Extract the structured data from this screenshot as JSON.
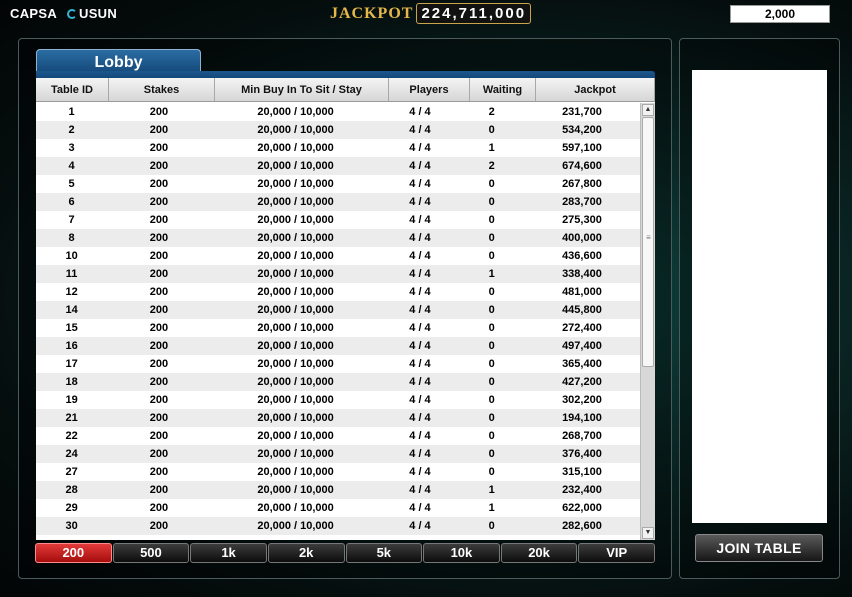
{
  "header": {
    "logo_left": "CAPSA",
    "logo_right": "USUN",
    "jackpot_label": "JACKPOT",
    "jackpot_value": "224,711,000",
    "balance": "2,000"
  },
  "lobby": {
    "tab_label": "Lobby",
    "columns": [
      "Table ID",
      "Stakes",
      "Min Buy In To Sit / Stay",
      "Players",
      "Waiting",
      "Jackpot"
    ],
    "rows": [
      {
        "id": "1",
        "stakes": "200",
        "buyin": "20,000 / 10,000",
        "players": "4 / 4",
        "waiting": "2",
        "jackpot": "231,700"
      },
      {
        "id": "2",
        "stakes": "200",
        "buyin": "20,000 / 10,000",
        "players": "4 / 4",
        "waiting": "0",
        "jackpot": "534,200"
      },
      {
        "id": "3",
        "stakes": "200",
        "buyin": "20,000 / 10,000",
        "players": "4 / 4",
        "waiting": "1",
        "jackpot": "597,100"
      },
      {
        "id": "4",
        "stakes": "200",
        "buyin": "20,000 / 10,000",
        "players": "4 / 4",
        "waiting": "2",
        "jackpot": "674,600"
      },
      {
        "id": "5",
        "stakes": "200",
        "buyin": "20,000 / 10,000",
        "players": "4 / 4",
        "waiting": "0",
        "jackpot": "267,800"
      },
      {
        "id": "6",
        "stakes": "200",
        "buyin": "20,000 / 10,000",
        "players": "4 / 4",
        "waiting": "0",
        "jackpot": "283,700"
      },
      {
        "id": "7",
        "stakes": "200",
        "buyin": "20,000 / 10,000",
        "players": "4 / 4",
        "waiting": "0",
        "jackpot": "275,300"
      },
      {
        "id": "8",
        "stakes": "200",
        "buyin": "20,000 / 10,000",
        "players": "4 / 4",
        "waiting": "0",
        "jackpot": "400,000"
      },
      {
        "id": "10",
        "stakes": "200",
        "buyin": "20,000 / 10,000",
        "players": "4 / 4",
        "waiting": "0",
        "jackpot": "436,600"
      },
      {
        "id": "11",
        "stakes": "200",
        "buyin": "20,000 / 10,000",
        "players": "4 / 4",
        "waiting": "1",
        "jackpot": "338,400"
      },
      {
        "id": "12",
        "stakes": "200",
        "buyin": "20,000 / 10,000",
        "players": "4 / 4",
        "waiting": "0",
        "jackpot": "481,000"
      },
      {
        "id": "14",
        "stakes": "200",
        "buyin": "20,000 / 10,000",
        "players": "4 / 4",
        "waiting": "0",
        "jackpot": "445,800"
      },
      {
        "id": "15",
        "stakes": "200",
        "buyin": "20,000 / 10,000",
        "players": "4 / 4",
        "waiting": "0",
        "jackpot": "272,400"
      },
      {
        "id": "16",
        "stakes": "200",
        "buyin": "20,000 / 10,000",
        "players": "4 / 4",
        "waiting": "0",
        "jackpot": "497,400"
      },
      {
        "id": "17",
        "stakes": "200",
        "buyin": "20,000 / 10,000",
        "players": "4 / 4",
        "waiting": "0",
        "jackpot": "365,400"
      },
      {
        "id": "18",
        "stakes": "200",
        "buyin": "20,000 / 10,000",
        "players": "4 / 4",
        "waiting": "0",
        "jackpot": "427,200"
      },
      {
        "id": "19",
        "stakes": "200",
        "buyin": "20,000 / 10,000",
        "players": "4 / 4",
        "waiting": "0",
        "jackpot": "302,200"
      },
      {
        "id": "21",
        "stakes": "200",
        "buyin": "20,000 / 10,000",
        "players": "4 / 4",
        "waiting": "0",
        "jackpot": "194,100"
      },
      {
        "id": "22",
        "stakes": "200",
        "buyin": "20,000 / 10,000",
        "players": "4 / 4",
        "waiting": "0",
        "jackpot": "268,700"
      },
      {
        "id": "24",
        "stakes": "200",
        "buyin": "20,000 / 10,000",
        "players": "4 / 4",
        "waiting": "0",
        "jackpot": "376,400"
      },
      {
        "id": "27",
        "stakes": "200",
        "buyin": "20,000 / 10,000",
        "players": "4 / 4",
        "waiting": "0",
        "jackpot": "315,100"
      },
      {
        "id": "28",
        "stakes": "200",
        "buyin": "20,000 / 10,000",
        "players": "4 / 4",
        "waiting": "1",
        "jackpot": "232,400"
      },
      {
        "id": "29",
        "stakes": "200",
        "buyin": "20,000 / 10,000",
        "players": "4 / 4",
        "waiting": "1",
        "jackpot": "622,000"
      },
      {
        "id": "30",
        "stakes": "200",
        "buyin": "20,000 / 10,000",
        "players": "4 / 4",
        "waiting": "0",
        "jackpot": "282,600"
      }
    ]
  },
  "stakes_tabs": [
    "200",
    "500",
    "1k",
    "2k",
    "5k",
    "10k",
    "20k",
    "VIP"
  ],
  "active_stake": "200",
  "join_button": "JOIN TABLE",
  "colors": {
    "active_tab": "#d42222",
    "lobby_tab": "#1d5a90",
    "jackpot_gold": "#e6b84a"
  }
}
